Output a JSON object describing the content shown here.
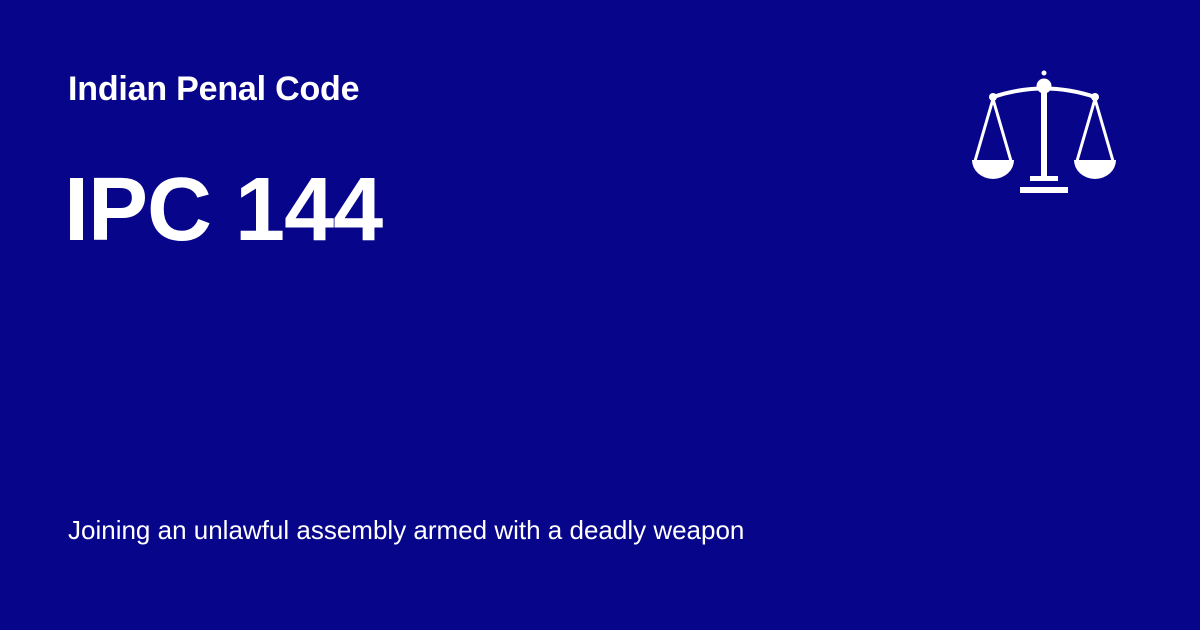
{
  "theme": {
    "background": "#07058A",
    "text": "#FFFFFF"
  },
  "header": {
    "category": "Indian Penal Code",
    "icon": "scales-of-justice-icon"
  },
  "main": {
    "section": "IPC 144",
    "description": "Joining an unlawful assembly armed with a deadly weapon"
  }
}
